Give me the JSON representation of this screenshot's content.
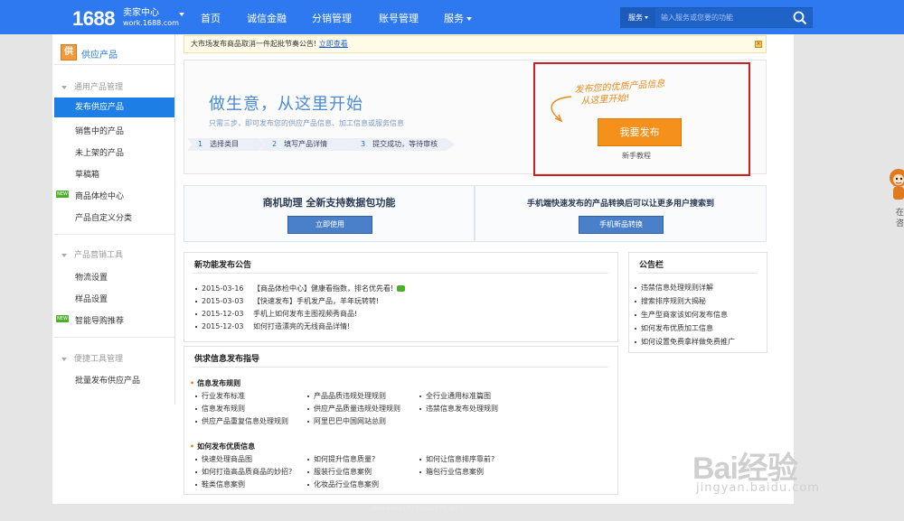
{
  "topbar": {
    "logo": "1688",
    "logo_title": "卖家中心",
    "logo_domain": "work.1688.com",
    "nav": [
      "首页",
      "诚信金融",
      "分销管理",
      "账号管理",
      "服务"
    ],
    "search_category": "服务",
    "search_placeholder": "输入服务或您要的功能"
  },
  "sidebar": {
    "header": "供应产品",
    "header_icon_char": "供",
    "groups": [
      {
        "title": "通用产品管理",
        "items": [
          "发布供应产品",
          "销售中的产品",
          "未上架的产品",
          "草稿箱",
          "商品体检中心",
          "产品自定义分类"
        ]
      },
      {
        "title": "产品营销工具",
        "items": [
          "物流设置",
          "样品设置",
          "智能导购推荐"
        ]
      },
      {
        "title": "便捷工具管理",
        "items": [
          "批量发布供应产品"
        ]
      }
    ],
    "new_tag": "NEW",
    "active_item": "发布供应产品"
  },
  "notice": {
    "text": "大市场发布商品取消一件起批节奏公告!",
    "link": "立即查看"
  },
  "hero": {
    "title": "做生意，从这里开始",
    "subtitle": "只需三步，即可发布您的供应产品信息、加工信息或服务信息",
    "steps": [
      {
        "num": "1",
        "label": "选择类目"
      },
      {
        "num": "2",
        "label": "填写产品详情"
      },
      {
        "num": "3",
        "label": "提交成功，等待审核"
      }
    ],
    "handwriting_line1": "发布您的优质产品信息",
    "handwriting_line2": "从这里开始!",
    "publish_button": "我要发布",
    "tutorial": "新手教程"
  },
  "promos": [
    {
      "title": "商机助理 全新支持数据包功能",
      "button": "立即使用"
    },
    {
      "title": "手机端快速发布的产品转换后可以让更多用户搜索到",
      "button": "手机新品转换"
    }
  ],
  "announcements": {
    "title": "新功能发布公告",
    "items": [
      {
        "date": "2015-03-16",
        "text": "【商品体检中心】健康看指数，排名优先看!"
      },
      {
        "date": "2015-03-03",
        "text": "【快速发布】手机发产品，羊年玩转转!"
      },
      {
        "date": "2015-12-03",
        "text": "手机上如何发布主图视频秀商品!"
      },
      {
        "date": "2015-12-03",
        "text": "如何打造漂亮的无线商品详情!"
      }
    ]
  },
  "bulletin": {
    "title": "公告栏",
    "items": [
      "违禁信息处理规则详解",
      "搜索排序规则大揭秘",
      "生产型商家该如何发布信息",
      "如何发布优质加工信息",
      "如何设置免费拿样做免费推广"
    ]
  },
  "guide": {
    "title": "供求信息发布指导",
    "sections": [
      {
        "title": "信息发布规则",
        "items": [
          "行业发布标准",
          "产品品质违规处理规则",
          "全行业通用标准篇图",
          "信息发布规则",
          "供应产品质量违规处理规则",
          "违禁信息发布处理规则",
          "供应产品重复信息处理规则",
          "阿里巴巴中国网站总则"
        ]
      },
      {
        "title": "如何发布优质信息",
        "items": [
          "快速处理商品图",
          "如何提升信息质量?",
          "如何让信息排序靠前?",
          "如何打造高品质商品的妙招?",
          "服装行业信息案例",
          "箱包行业信息案例",
          "鞋类信息案例",
          "化妆品行业信息案例"
        ]
      }
    ]
  },
  "footer": "offerweb010101030525.et15",
  "side_widget": {
    "text1": "在",
    "text2": "咨"
  },
  "watermark": {
    "logo": "Bai经验",
    "url": "jingyan.baidu.com"
  }
}
